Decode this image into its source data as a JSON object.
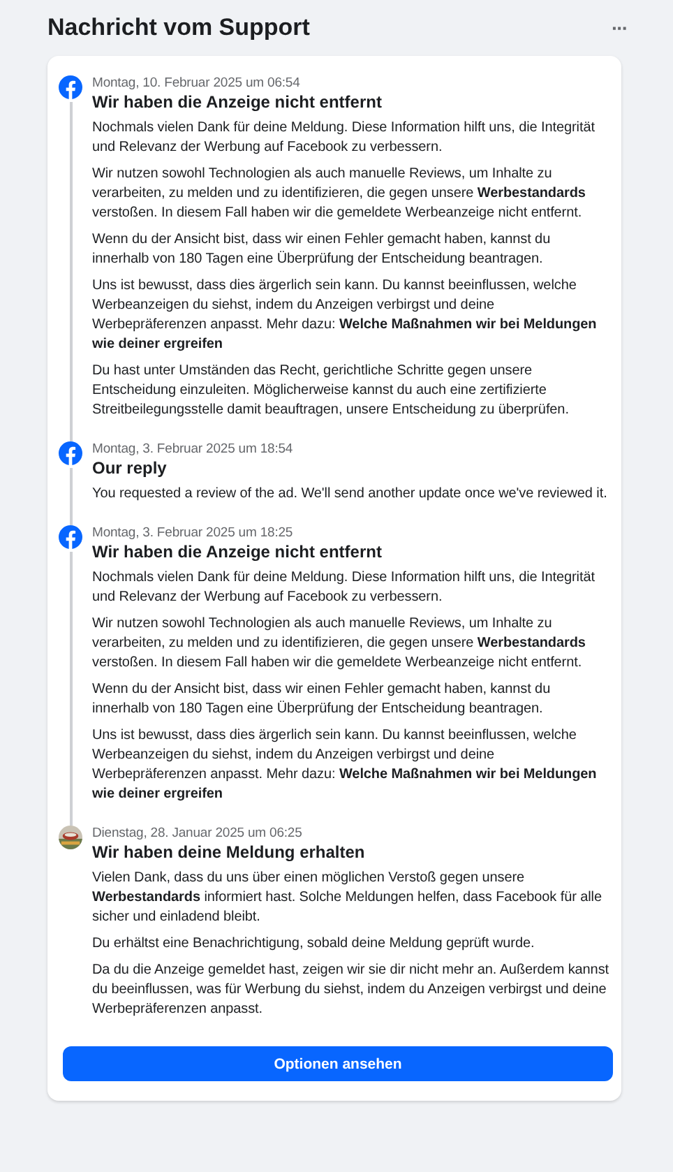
{
  "header": {
    "title": "Nachricht vom Support",
    "more": "···"
  },
  "messages": [
    {
      "avatar": {
        "kind": "facebook"
      },
      "date": "Montag, 10. Februar 2025 um 06:54",
      "title": "Wir haben die Anzeige nicht entfernt",
      "paragraphs": [
        "Nochmals vielen Dank für deine Meldung. Diese Information hilft uns, die Integrität und Relevanz der Werbung auf Facebook zu verbessern.",
        "Wir nutzen sowohl Technologien als auch manuelle Reviews, um Inhalte zu verarbeiten, zu melden und zu identifizieren, die gegen unsere **Werbestandards** verstoßen. In diesem Fall haben wir die gemeldete Werbeanzeige nicht entfernt.",
        "Wenn du der Ansicht bist, dass wir einen Fehler gemacht haben, kannst du innerhalb von 180 Tagen eine Überprüfung der Entscheidung beantragen.",
        "Uns ist bewusst, dass dies ärgerlich sein kann. Du kannst beeinflussen, welche Werbeanzeigen du siehst, indem du Anzeigen verbirgst und deine Werbepräferenzen anpasst. Mehr dazu: **Welche Maßnahmen wir bei Meldungen wie deiner ergreifen**",
        "Du hast unter Umständen das Recht, gerichtliche Schritte gegen unsere Entscheidung einzuleiten. Möglicherweise kannst du auch eine zertifizierte Streitbeilegungsstelle damit beauftragen, unsere Entscheidung zu überprüfen."
      ]
    },
    {
      "avatar": {
        "kind": "facebook"
      },
      "date": "Montag, 3. Februar 2025 um 18:54",
      "title": "Our reply",
      "paragraphs": [
        "You requested a review of the ad. We'll send another update once we've reviewed it."
      ]
    },
    {
      "avatar": {
        "kind": "facebook"
      },
      "date": "Montag, 3. Februar 2025 um 18:25",
      "title": "Wir haben die Anzeige nicht entfernt",
      "paragraphs": [
        "Nochmals vielen Dank für deine Meldung. Diese Information hilft uns, die Integrität und Relevanz der Werbung auf Facebook zu verbessern.",
        "Wir nutzen sowohl Technologien als auch manuelle Reviews, um Inhalte zu verarbeiten, zu melden und zu identifizieren, die gegen unsere **Werbestandards** verstoßen. In diesem Fall haben wir die gemeldete Werbeanzeige nicht entfernt.",
        "Wenn du der Ansicht bist, dass wir einen Fehler gemacht haben, kannst du innerhalb von 180 Tagen eine Überprüfung der Entscheidung beantragen.",
        "Uns ist bewusst, dass dies ärgerlich sein kann. Du kannst beeinflussen, welche Werbeanzeigen du siehst, indem du Anzeigen verbirgst und deine Werbepräferenzen anpasst. Mehr dazu: **Welche Maßnahmen wir bei Meldungen wie deiner ergreifen**"
      ]
    },
    {
      "avatar": {
        "kind": "picture"
      },
      "date": "Dienstag, 28. Januar 2025 um 06:25",
      "title": "Wir haben deine Meldung erhalten",
      "paragraphs": [
        "Vielen Dank, dass du uns über einen möglichen Verstoß gegen unsere **Werbestandards** informiert hast. Solche Meldungen helfen, dass Facebook für alle sicher und einladend bleibt.",
        "Du erhältst eine Benachrichtigung, sobald deine Meldung geprüft wurde.",
        "Da du die Anzeige gemeldet hast, zeigen wir sie dir nicht mehr an. Außerdem kannst du beeinflussen, was für Werbung du siehst, indem du Anzeigen verbirgst und deine Werbepräferenzen anpasst."
      ]
    }
  ],
  "button": {
    "label": "Optionen ansehen"
  }
}
